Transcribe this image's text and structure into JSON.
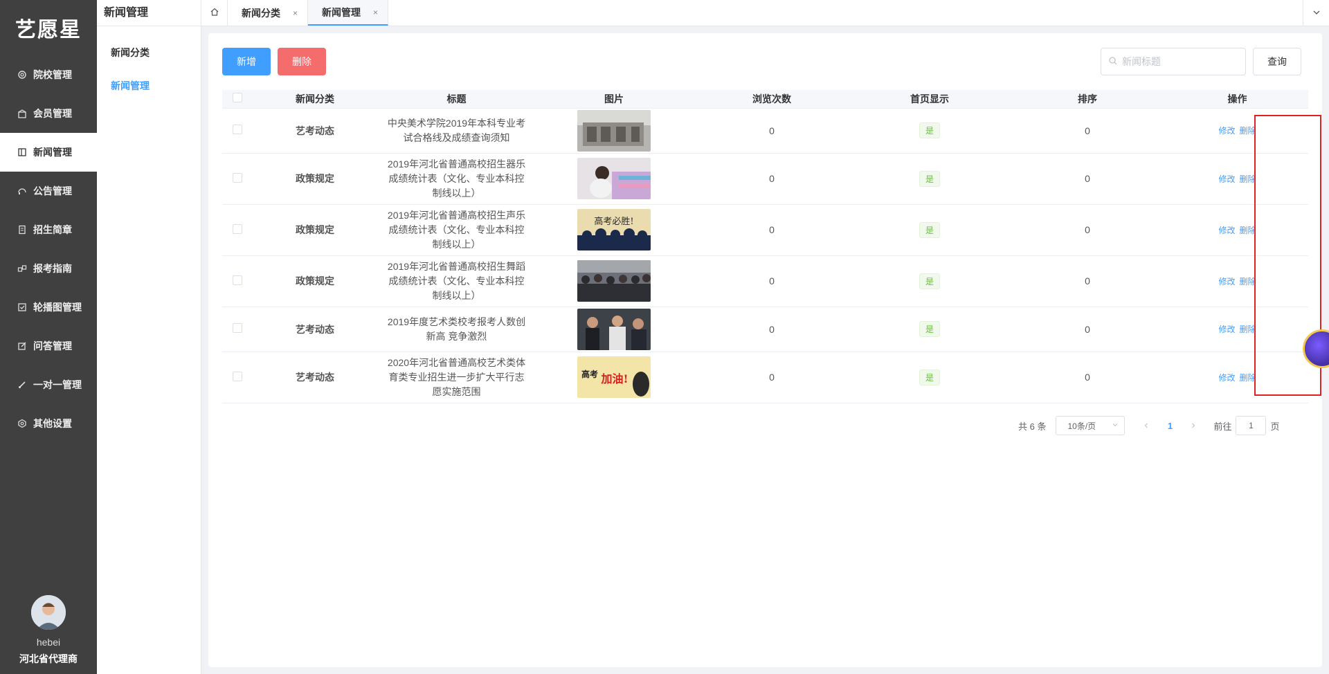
{
  "logo": "艺愿星",
  "sidebar": {
    "items": [
      {
        "label": "院校管理",
        "icon": "gear-icon"
      },
      {
        "label": "会员管理",
        "icon": "gift-icon"
      },
      {
        "label": "新闻管理",
        "icon": "news-icon",
        "active": true
      },
      {
        "label": "公告管理",
        "icon": "headset-icon"
      },
      {
        "label": "招生简章",
        "icon": "document-icon"
      },
      {
        "label": "报考指南",
        "icon": "guide-icon"
      },
      {
        "label": "轮播图管理",
        "icon": "checkbox-icon"
      },
      {
        "label": "问答管理",
        "icon": "edit-icon"
      },
      {
        "label": "一对一管理",
        "icon": "brush-icon"
      },
      {
        "label": "其他设置",
        "icon": "settings-icon"
      }
    ],
    "user": {
      "name": "hebei",
      "role": "河北省代理商"
    }
  },
  "submenu": {
    "title": "新闻管理",
    "items": [
      {
        "label": "新闻分类"
      },
      {
        "label": "新闻管理",
        "active": true
      }
    ]
  },
  "tabs": [
    {
      "label": "新闻分类",
      "close": "×"
    },
    {
      "label": "新闻管理",
      "close": "×",
      "active": true
    }
  ],
  "toolbar": {
    "add_label": "新增",
    "delete_label": "删除",
    "search_placeholder": "新闻标题",
    "query_label": "查询"
  },
  "table": {
    "headers": [
      "新闻分类",
      "标题",
      "图片",
      "浏览次数",
      "首页显示",
      "排序",
      "操作"
    ],
    "rows": [
      {
        "category": "艺考动态",
        "title": "中央美术学院2019年本科专业考试合格线及成绩查询须知",
        "image": "building-photo",
        "views": "0",
        "home": "是",
        "order": "0",
        "edit": "修改",
        "del": "删除"
      },
      {
        "category": "政策规定",
        "title": "2019年河北省普通高校招生器乐成绩统计表（文化、专业本科控制线以上）",
        "image": "child-painting-photo",
        "views": "0",
        "home": "是",
        "order": "0",
        "edit": "修改",
        "del": "删除"
      },
      {
        "category": "政策规定",
        "title": "2019年河北省普通高校招生声乐成绩统计表（文化、专业本科控制线以上）",
        "image": "exam-silhouette-photo",
        "views": "0",
        "home": "是",
        "order": "0",
        "edit": "修改",
        "del": "删除"
      },
      {
        "category": "政策规定",
        "title": "2019年河北省普通高校招生舞蹈成绩统计表（文化、专业本科控制线以上）",
        "image": "crowd-photo",
        "views": "0",
        "home": "是",
        "order": "0",
        "edit": "修改",
        "del": "删除"
      },
      {
        "category": "艺考动态",
        "title": "2019年度艺术类校考报考人数创新高 竞争激烈",
        "image": "students-photo",
        "views": "0",
        "home": "是",
        "order": "0",
        "edit": "修改",
        "del": "删除"
      },
      {
        "category": "艺考动态",
        "title": "2020年河北省普通高校艺术类体育类专业招生进一步扩大平行志愿实施范围",
        "image": "gaokao-jiayou-poster",
        "views": "0",
        "home": "是",
        "order": "0",
        "edit": "修改",
        "del": "删除"
      }
    ]
  },
  "pagination": {
    "total": "共 6 条",
    "page_size": "10条/页",
    "current_page": "1",
    "goto_prefix": "前往",
    "goto_value": "1",
    "goto_suffix": "页"
  },
  "image_text": {
    "exam_banner": "高考必胜!",
    "poster_left": "高考",
    "poster_right": "加油!"
  },
  "colors": {
    "sidebar_bg": "#404040",
    "primary": "#409eff",
    "danger": "#f56c6c",
    "success": "#67c23a",
    "highlight": "#e02020"
  }
}
